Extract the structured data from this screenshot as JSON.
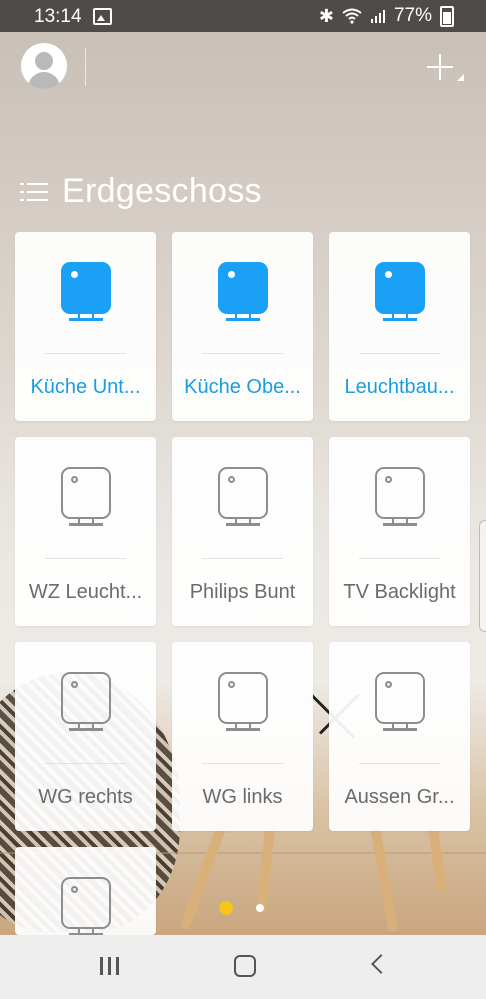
{
  "status_bar": {
    "time": "13:14",
    "battery": "77%",
    "icons": [
      "image-icon",
      "bluetooth-icon",
      "wifi-icon",
      "signal-icon",
      "battery-icon"
    ]
  },
  "header": {
    "avatar_icon": "user-avatar-icon",
    "add_icon": "plus-icon"
  },
  "group": {
    "title": "Erdgeschoss",
    "icon": "list-menu-icon"
  },
  "devices": [
    {
      "label": "Küche Unt...",
      "state": "on"
    },
    {
      "label": "Küche Obe...",
      "state": "on"
    },
    {
      "label": "Leuchtbau...",
      "state": "on"
    },
    {
      "label": "WZ Leucht...",
      "state": "off"
    },
    {
      "label": "Philips Bunt",
      "state": "off"
    },
    {
      "label": "TV Backlight",
      "state": "off"
    },
    {
      "label": "WG rechts",
      "state": "off"
    },
    {
      "label": "WG links",
      "state": "off"
    },
    {
      "label": "Aussen Gr...",
      "state": "off"
    },
    {
      "label": "",
      "state": "off"
    }
  ],
  "pager": {
    "pages": 2,
    "current": 1
  },
  "colors": {
    "accent_on": "#1aa0f5",
    "label_on": "#1a9de0",
    "icon_off": "#8d8d8d",
    "page_dot_active": "#f5c518"
  },
  "nav_bar": {
    "buttons": [
      "recents-icon",
      "home-icon",
      "back-icon"
    ]
  }
}
